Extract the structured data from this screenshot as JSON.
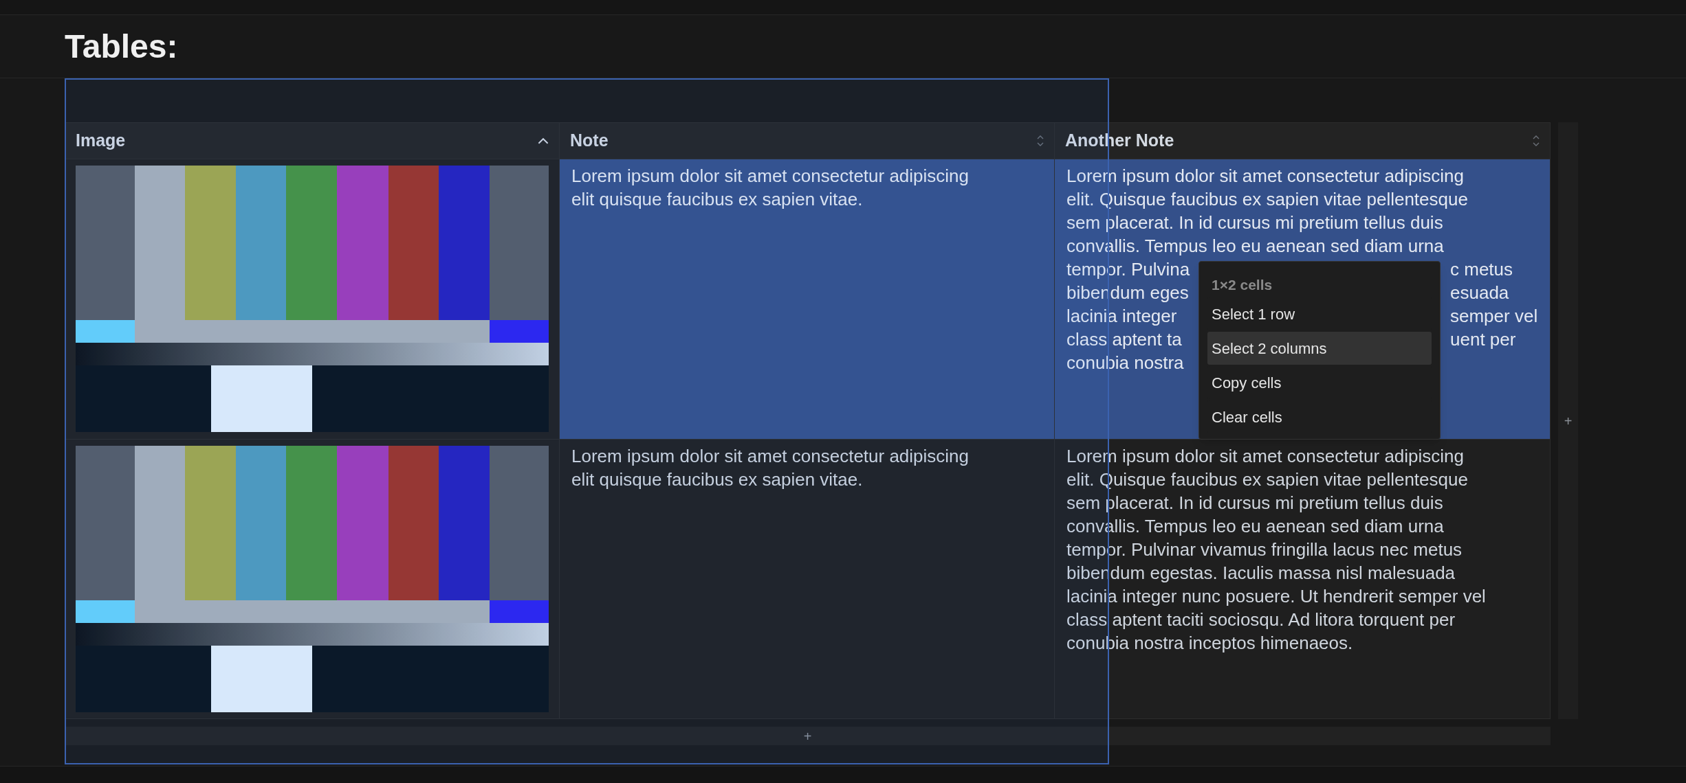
{
  "page_title": "Tables:",
  "table": {
    "columns": [
      {
        "label": "Image",
        "kind": "ascending"
      },
      {
        "label": "Note",
        "kind": "sortable"
      },
      {
        "label": "Another Note",
        "kind": "sortable"
      }
    ],
    "rows": [
      {
        "cells": [
          {
            "kind": "picture",
            "selected": false
          },
          {
            "kind": "text",
            "selected": true,
            "lines": [
              [
                "Lorem ipsum dolor sit amet consectetur adipiscing"
              ],
              [
                "elit quisque faucibus ex sapien vitae."
              ]
            ]
          },
          {
            "kind": "text",
            "selected": true,
            "lines": [
              [
                "Lorem ipsum dolor sit amet consectetur adipiscing"
              ],
              [
                "elit. Quisque faucibus ex sapien vitae pellentesque"
              ],
              [
                "sem placerat. In id cursus mi pretium tellus duis"
              ],
              [
                "convallis. Tempus leo eu aenean sed diam urna"
              ],
              [
                "tempor. Pulvina",
                "c metus"
              ],
              [
                "bibendum eges",
                "esuada"
              ],
              [
                "lacinia integer",
                "semper vel"
              ],
              [
                "class aptent ta",
                "uent per"
              ],
              [
                "conubia nostra"
              ]
            ]
          }
        ]
      },
      {
        "cells": [
          {
            "kind": "picture",
            "selected": false
          },
          {
            "kind": "text",
            "selected": false,
            "lines": [
              [
                "Lorem ipsum dolor sit amet consectetur adipiscing"
              ],
              [
                "elit quisque faucibus ex sapien vitae."
              ]
            ]
          },
          {
            "kind": "text",
            "selected": false,
            "lines": [
              [
                "Lorem ipsum dolor sit amet consectetur adipiscing"
              ],
              [
                "elit. Quisque faucibus ex sapien vitae pellentesque"
              ],
              [
                "sem placerat. In id cursus mi pretium tellus duis"
              ],
              [
                "convallis. Tempus leo eu aenean sed diam urna"
              ],
              [
                "tempor. Pulvinar vivamus fringilla lacus nec metus"
              ],
              [
                "bibendum egestas. Iaculis massa nisl malesuada"
              ],
              [
                "lacinia integer nunc posuere. Ut hendrerit semper vel"
              ],
              [
                "class aptent taciti sociosqu. Ad litora torquent per"
              ],
              [
                "conubia nostra inceptos himenaeos."
              ]
            ]
          }
        ]
      }
    ]
  },
  "add_column_button": "+",
  "add_row_button": "+",
  "context_menu": {
    "header": "1×2 cells",
    "items": [
      {
        "label": "Select 1 row",
        "highlighted": false
      },
      {
        "label": "Select 2 columns",
        "highlighted": true
      },
      {
        "label": "Copy cells",
        "highlighted": false
      },
      {
        "label": "Clear cells",
        "highlighted": false
      }
    ]
  }
}
